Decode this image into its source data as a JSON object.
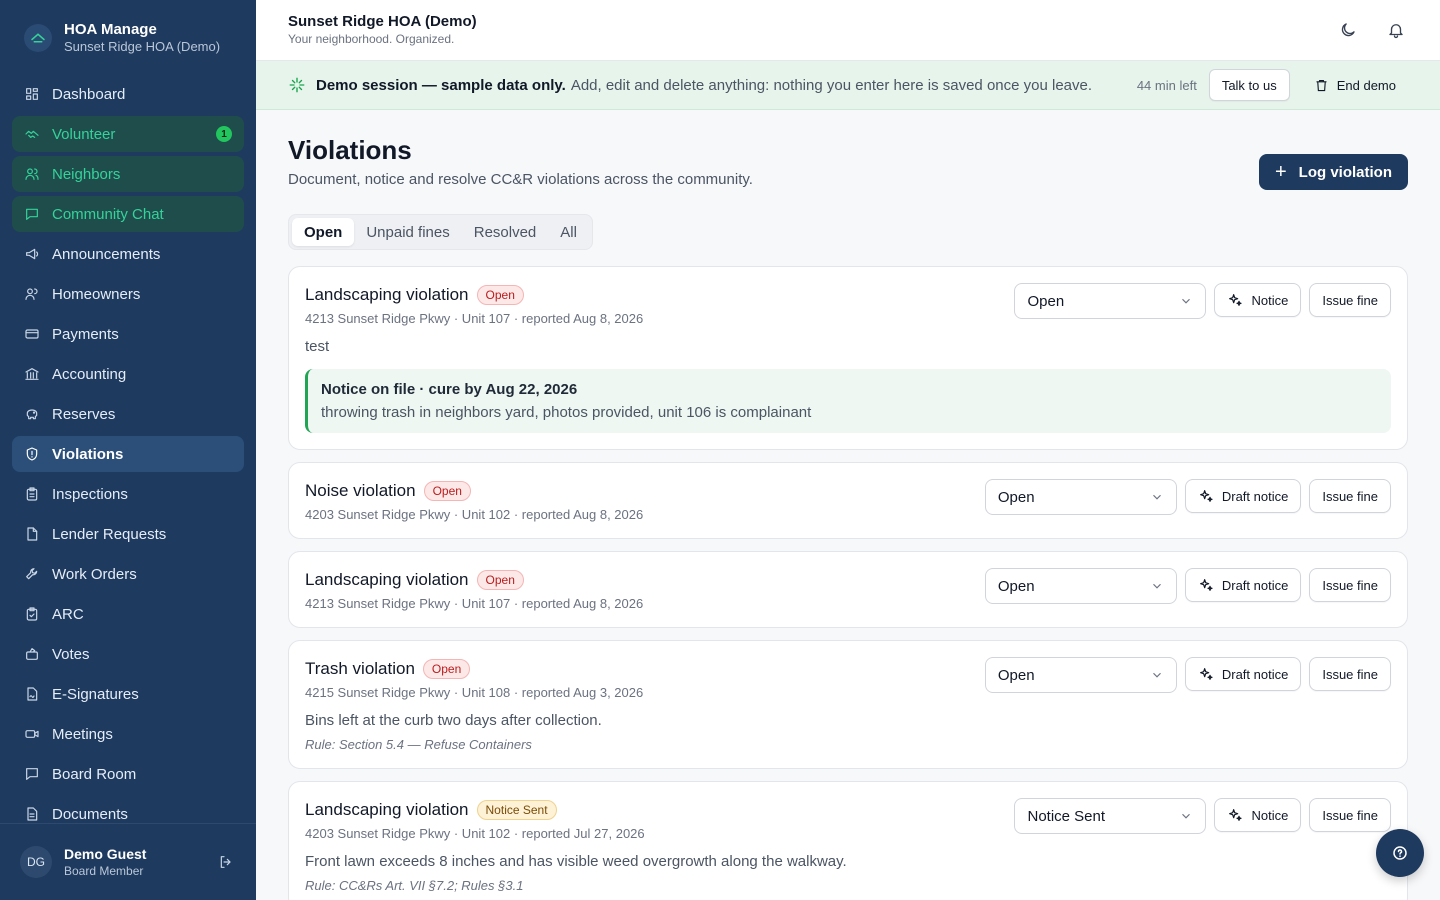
{
  "brand": {
    "title": "HOA Manage",
    "subtitle": "Sunset Ridge HOA (Demo)",
    "icon": "logo-icon"
  },
  "sidebar": {
    "items": [
      {
        "label": "Dashboard",
        "icon": "grid-icon"
      },
      {
        "label": "Volunteer",
        "icon": "handshake-icon",
        "badge": "1"
      },
      {
        "label": "Neighbors",
        "icon": "users-icon"
      },
      {
        "label": "Community Chat",
        "icon": "chat-icon"
      },
      {
        "label": "Announcements",
        "icon": "megaphone-icon"
      },
      {
        "label": "Homeowners",
        "icon": "people-icon"
      },
      {
        "label": "Payments",
        "icon": "card-icon"
      },
      {
        "label": "Accounting",
        "icon": "bank-icon"
      },
      {
        "label": "Reserves",
        "icon": "piggy-bank-icon"
      },
      {
        "label": "Violations",
        "icon": "shield-icon"
      },
      {
        "label": "Inspections",
        "icon": "clipboard-icon"
      },
      {
        "label": "Lender Requests",
        "icon": "file-icon"
      },
      {
        "label": "Work Orders",
        "icon": "wrench-icon"
      },
      {
        "label": "ARC",
        "icon": "clipboard-check-icon"
      },
      {
        "label": "Votes",
        "icon": "ballot-icon"
      },
      {
        "label": "E-Signatures",
        "icon": "signature-icon"
      },
      {
        "label": "Meetings",
        "icon": "video-icon"
      },
      {
        "label": "Board Room",
        "icon": "message-square-icon"
      },
      {
        "label": "Documents",
        "icon": "document-icon"
      }
    ]
  },
  "user": {
    "initials": "DG",
    "name": "Demo Guest",
    "role": "Board Member"
  },
  "header": {
    "title": "Sunset Ridge HOA (Demo)",
    "subtitle": "Your neighborhood. Organized."
  },
  "banner": {
    "strong": "Demo session — sample data only.",
    "text": "Add, edit and delete anything: nothing you enter here is saved once you leave.",
    "time_left": "44 min left",
    "talk_label": "Talk to us",
    "end_label": "End demo"
  },
  "page": {
    "title": "Violations",
    "subtitle": "Document, notice and resolve CC&R violations across the community.",
    "log_button": "Log violation",
    "tabs": [
      "Open",
      "Unpaid fines",
      "Resolved",
      "All"
    ]
  },
  "violations": [
    {
      "title": "Landscaping violation",
      "badge": "Open",
      "meta": "4213 Sunset Ridge Pkwy · Unit 107 · reported Aug 8, 2026",
      "description": "test",
      "status": "Open",
      "notice_label": "Notice",
      "fine_label": "Issue fine",
      "notice_title": "Notice on file · cure by Aug 22, 2026",
      "notice_body": "throwing trash in neighbors yard, photos provided, unit 106 is complainant"
    },
    {
      "title": "Noise violation",
      "badge": "Open",
      "meta": "4203 Sunset Ridge Pkwy · Unit 102 · reported Aug 8, 2026",
      "status": "Open",
      "notice_label": "Draft notice",
      "fine_label": "Issue fine"
    },
    {
      "title": "Landscaping violation",
      "badge": "Open",
      "meta": "4213 Sunset Ridge Pkwy · Unit 107 · reported Aug 8, 2026",
      "status": "Open",
      "notice_label": "Draft notice",
      "fine_label": "Issue fine"
    },
    {
      "title": "Trash violation",
      "badge": "Open",
      "meta": "4215 Sunset Ridge Pkwy · Unit 108 · reported Aug 3, 2026",
      "description": "Bins left at the curb two days after collection.",
      "rule": "Rule: Section 5.4 — Refuse Containers",
      "status": "Open",
      "notice_label": "Draft notice",
      "fine_label": "Issue fine"
    },
    {
      "title": "Landscaping violation",
      "badge": "Notice Sent",
      "meta": "4203 Sunset Ridge Pkwy · Unit 102 · reported Jul 27, 2026",
      "description": "Front lawn exceeds 8 inches and has visible weed overgrowth along the walkway.",
      "rule": "Rule: CC&Rs Art. VII §7.2; Rules §3.1",
      "status": "Notice Sent",
      "notice_label": "Notice",
      "fine_label": "Issue fine"
    }
  ],
  "colors": {
    "sidebar": "#1e3a5f",
    "accent_green": "#34d399",
    "banner": "#e6f4ec",
    "primary": "#1e3a5f"
  }
}
